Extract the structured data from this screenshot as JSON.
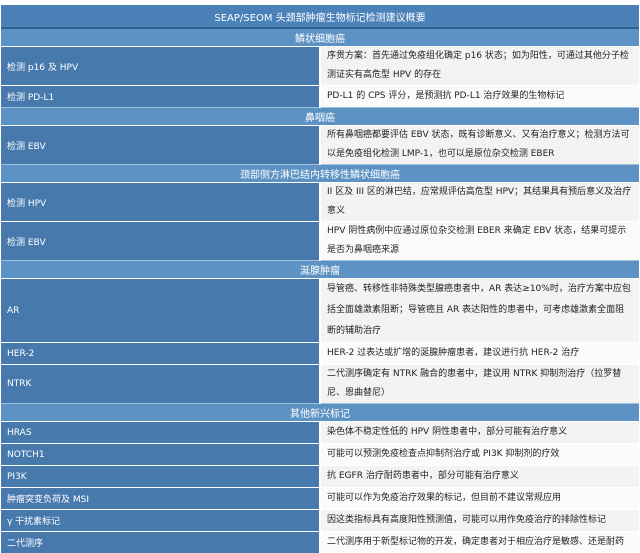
{
  "title": "SEAP/SEOM 头颈部肿瘤生物标记检测建议概要",
  "sections": [
    {
      "heading": "鳞状细胞癌",
      "rows": [
        {
          "label": "检测 p16 及 HPV",
          "text": "序贯方案：首先通过免疫组化确定 p16 状态；如为阳性，可通过其他分子检测证实有高危型 HPV 的存在"
        },
        {
          "label": "检测 PD-L1",
          "text": "PD-L1 的 CPS 评分，是预测抗 PD-L1 治疗效果的生物标记"
        }
      ]
    },
    {
      "heading": "鼻咽癌",
      "rows": [
        {
          "label": "检测 EBV",
          "text": "所有鼻咽癌都要评估 EBV 状态，既有诊断意义、又有治疗意义；检测方法可以是免疫组化检测 LMP-1，也可以是原位杂交检测 EBER"
        }
      ]
    },
    {
      "heading": "颈部侧方淋巴结内转移性鳞状细胞癌",
      "rows": [
        {
          "label": "检测 HPV",
          "text": "II 区及 III 区的淋巴结，应常规评估高危型 HPV；其结果具有预后意义及治疗意义"
        },
        {
          "label": "检测 EBV",
          "text": "HPV 阴性病例中应通过原位杂交检测 EBER 来确定 EBV 状态，结果可提示是否为鼻咽癌来源"
        }
      ]
    },
    {
      "heading": "涎腺肿瘤",
      "rows": [
        {
          "label": "AR",
          "text": "导管癌、转移性非特殊类型腺癌患者中，AR 表达≥10%时，治疗方案中应包括全面雄激素阻断；导管癌且 AR 表达阳性的患者中，可考虑雄激素全面阻断的辅助治疗",
          "tall": true
        },
        {
          "label": "HER-2",
          "text": "HER-2 过表达或扩增的涎腺肿瘤患者，建议进行抗 HER-2 治疗"
        },
        {
          "label": "NTRK",
          "text": "二代测序确定有 NTRK 融合的患者中，建议用 NTRK 抑制剂治疗（拉罗替尼、恩曲替尼）"
        }
      ]
    },
    {
      "heading": "其他新兴标记",
      "rows": [
        {
          "label": "HRAS",
          "text": "染色体不稳定性低的 HPV 阴性患者中，部分可能有治疗意义"
        },
        {
          "label": "NOTCH1",
          "text": "可能可以预测免疫检查点抑制剂治疗或 PI3K 抑制剂的疗效"
        },
        {
          "label": "PI3K",
          "text": "抗 EGFR 治疗耐药患者中，部分可能有治疗意义"
        },
        {
          "label": "肿瘤突变负荷及 MSI",
          "text": "可能可以作为免疫治疗效果的标记，但目前不建议常规应用"
        },
        {
          "label": "γ 干扰素标记",
          "text": "因这类指标具有高度阳性预测值，可能可以用作免疫治疗的排除性标记"
        },
        {
          "label": "二代测序",
          "text": "二代测序用于新型标记物的开发，确定患者对于相应治疗是敏感、还是耐药"
        }
      ]
    }
  ]
}
